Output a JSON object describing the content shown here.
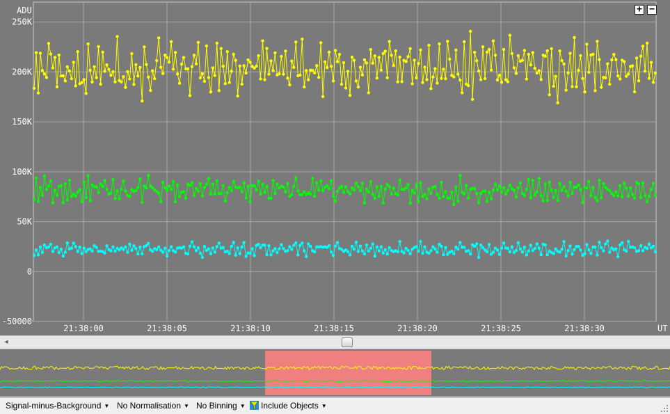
{
  "chart_data": {
    "type": "line",
    "ylabel": "ADU",
    "xlabel": "UT",
    "ylim": [
      -50000,
      270000
    ],
    "yticks": [
      -50000,
      0,
      50000,
      100000,
      150000,
      200000,
      250000
    ],
    "ytick_labels": [
      "-50000",
      "0",
      "50K",
      "100K",
      "150K",
      "200K",
      "250K"
    ],
    "xlim_seconds": [
      57.2,
      72.2
    ],
    "xticks": [
      60,
      65,
      70,
      75,
      80,
      85,
      90
    ],
    "xtick_labels": [
      "21:38:00",
      "21:38:05",
      "21:38:10",
      "21:38:15",
      "21:38:20",
      "21:38:25",
      "21:38:30"
    ],
    "grid": true,
    "series": [
      {
        "color": "#ffff00",
        "mean": 203000,
        "spread": 22000,
        "values": [
          200000,
          215000,
          175000,
          230000,
          190000,
          210000,
          185000,
          225000,
          205000,
          195000,
          240000,
          180000,
          220000,
          200000,
          210000,
          190000,
          230000,
          185000,
          205000,
          215000,
          175000,
          225000,
          200000,
          195000,
          210000,
          185000,
          220000,
          205000,
          190000,
          235000,
          200000,
          215000,
          180000,
          225000,
          205000,
          190000,
          210000,
          200000,
          220000,
          185000,
          230000,
          195000,
          205000,
          215000,
          190000,
          225000,
          200000,
          210000,
          180000,
          220000
        ]
      },
      {
        "color": "#00ff00",
        "mean": 80000,
        "spread": 10000,
        "values": [
          80000,
          90000,
          70000,
          85000,
          75000,
          95000,
          78000,
          82000,
          88000,
          72000,
          84000,
          76000,
          90000,
          80000,
          70000,
          86000,
          79000,
          92000,
          74000,
          83000,
          81000,
          77000,
          89000,
          73000,
          85000,
          80000,
          94000,
          76000,
          82000,
          78000,
          87000,
          71000,
          84000,
          80000,
          90000,
          75000,
          83000,
          79000,
          88000,
          74000,
          86000,
          81000,
          77000,
          91000,
          80000,
          72000,
          85000,
          78000,
          89000,
          82000
        ]
      },
      {
        "color": "#00ffff",
        "mean": 22000,
        "spread": 6000,
        "values": [
          20000,
          26000,
          17000,
          24000,
          21000,
          28000,
          19000,
          23000,
          25000,
          18000,
          22000,
          27000,
          20000,
          24000,
          16000,
          23000,
          26000,
          19000,
          22000,
          25000,
          21000,
          18000,
          27000,
          23000,
          20000,
          24000,
          30000,
          19000,
          22000,
          25000,
          21000,
          17000,
          24000,
          26000,
          20000,
          23000,
          28000,
          19000,
          22000,
          25000,
          21000,
          18000,
          26000,
          23000,
          20000,
          24000,
          27000,
          19000,
          22000,
          21000
        ]
      }
    ]
  },
  "controls": {
    "zoom_in": "+",
    "zoom_out": "−"
  },
  "toolbar": {
    "mode": "Signal-minus-Background",
    "normalisation": "No Normalisation",
    "binning": "No Binning",
    "objects": "Include Objects",
    "arrow": "▼"
  },
  "overview": {
    "selection_color": "#f08080"
  }
}
